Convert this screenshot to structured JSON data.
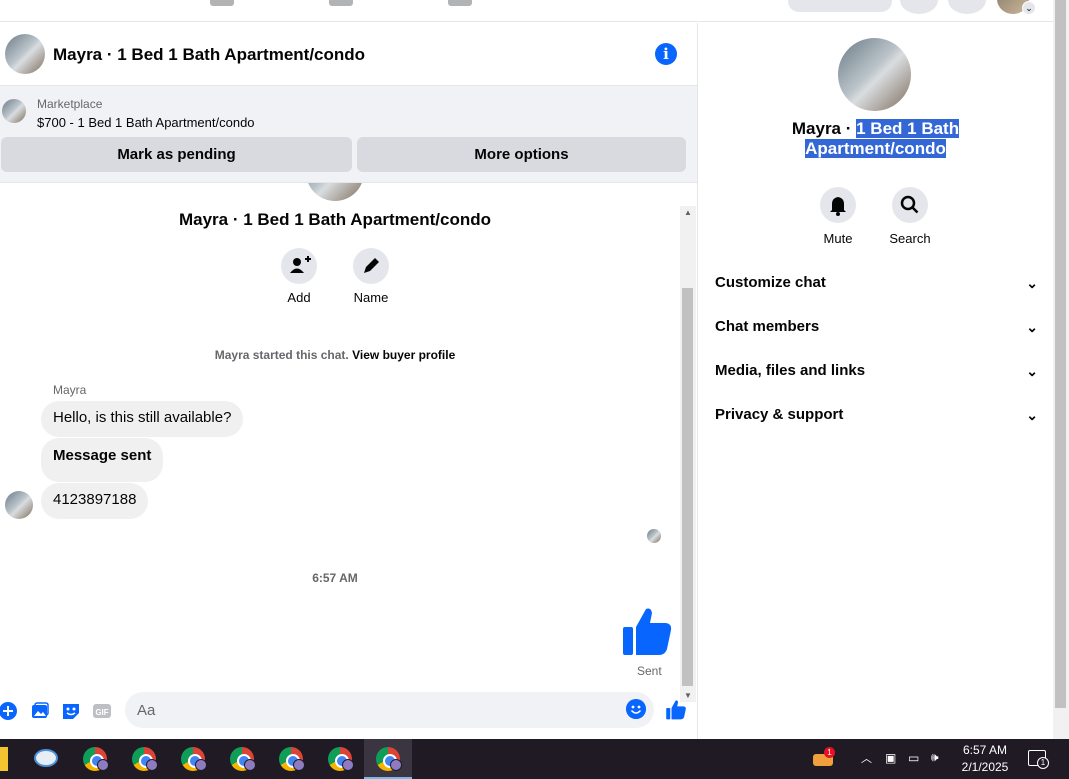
{
  "chat": {
    "title": "Mayra · 1 Bed 1 Bath Apartment/condo",
    "marketplace_label": "Marketplace",
    "listing": "$700 - 1 Bed 1 Bath Apartment/condo",
    "mark_pending": "Mark as pending",
    "more_options": "More options",
    "conversation_title": "Mayra · 1 Bed 1 Bath Apartment/condo",
    "actions": {
      "add": "Add",
      "name": "Name"
    },
    "started_text": "Mayra started this chat.",
    "view_profile": "View buyer profile",
    "sender": "Mayra",
    "messages": [
      "Hello, is this still available?",
      "Message sent",
      "4123897188"
    ],
    "timestamp": "6:57 AM",
    "sent_status": "Sent",
    "composer_placeholder": "Aa"
  },
  "info": {
    "name_plain": "Mayra · ",
    "name_highlight": "1 Bed 1 Bath Apartment/condo",
    "mute": "Mute",
    "search": "Search",
    "sections": [
      "Customize chat",
      "Chat members",
      "Media, files and links",
      "Privacy & support"
    ]
  },
  "taskbar": {
    "notification_badge": "1",
    "time": "6:57 AM",
    "date": "2/1/2025",
    "action_center_badge": "1"
  },
  "colors": {
    "accent": "#0866ff",
    "bubble": "#f0f0f0",
    "highlight": "#3367d6"
  }
}
